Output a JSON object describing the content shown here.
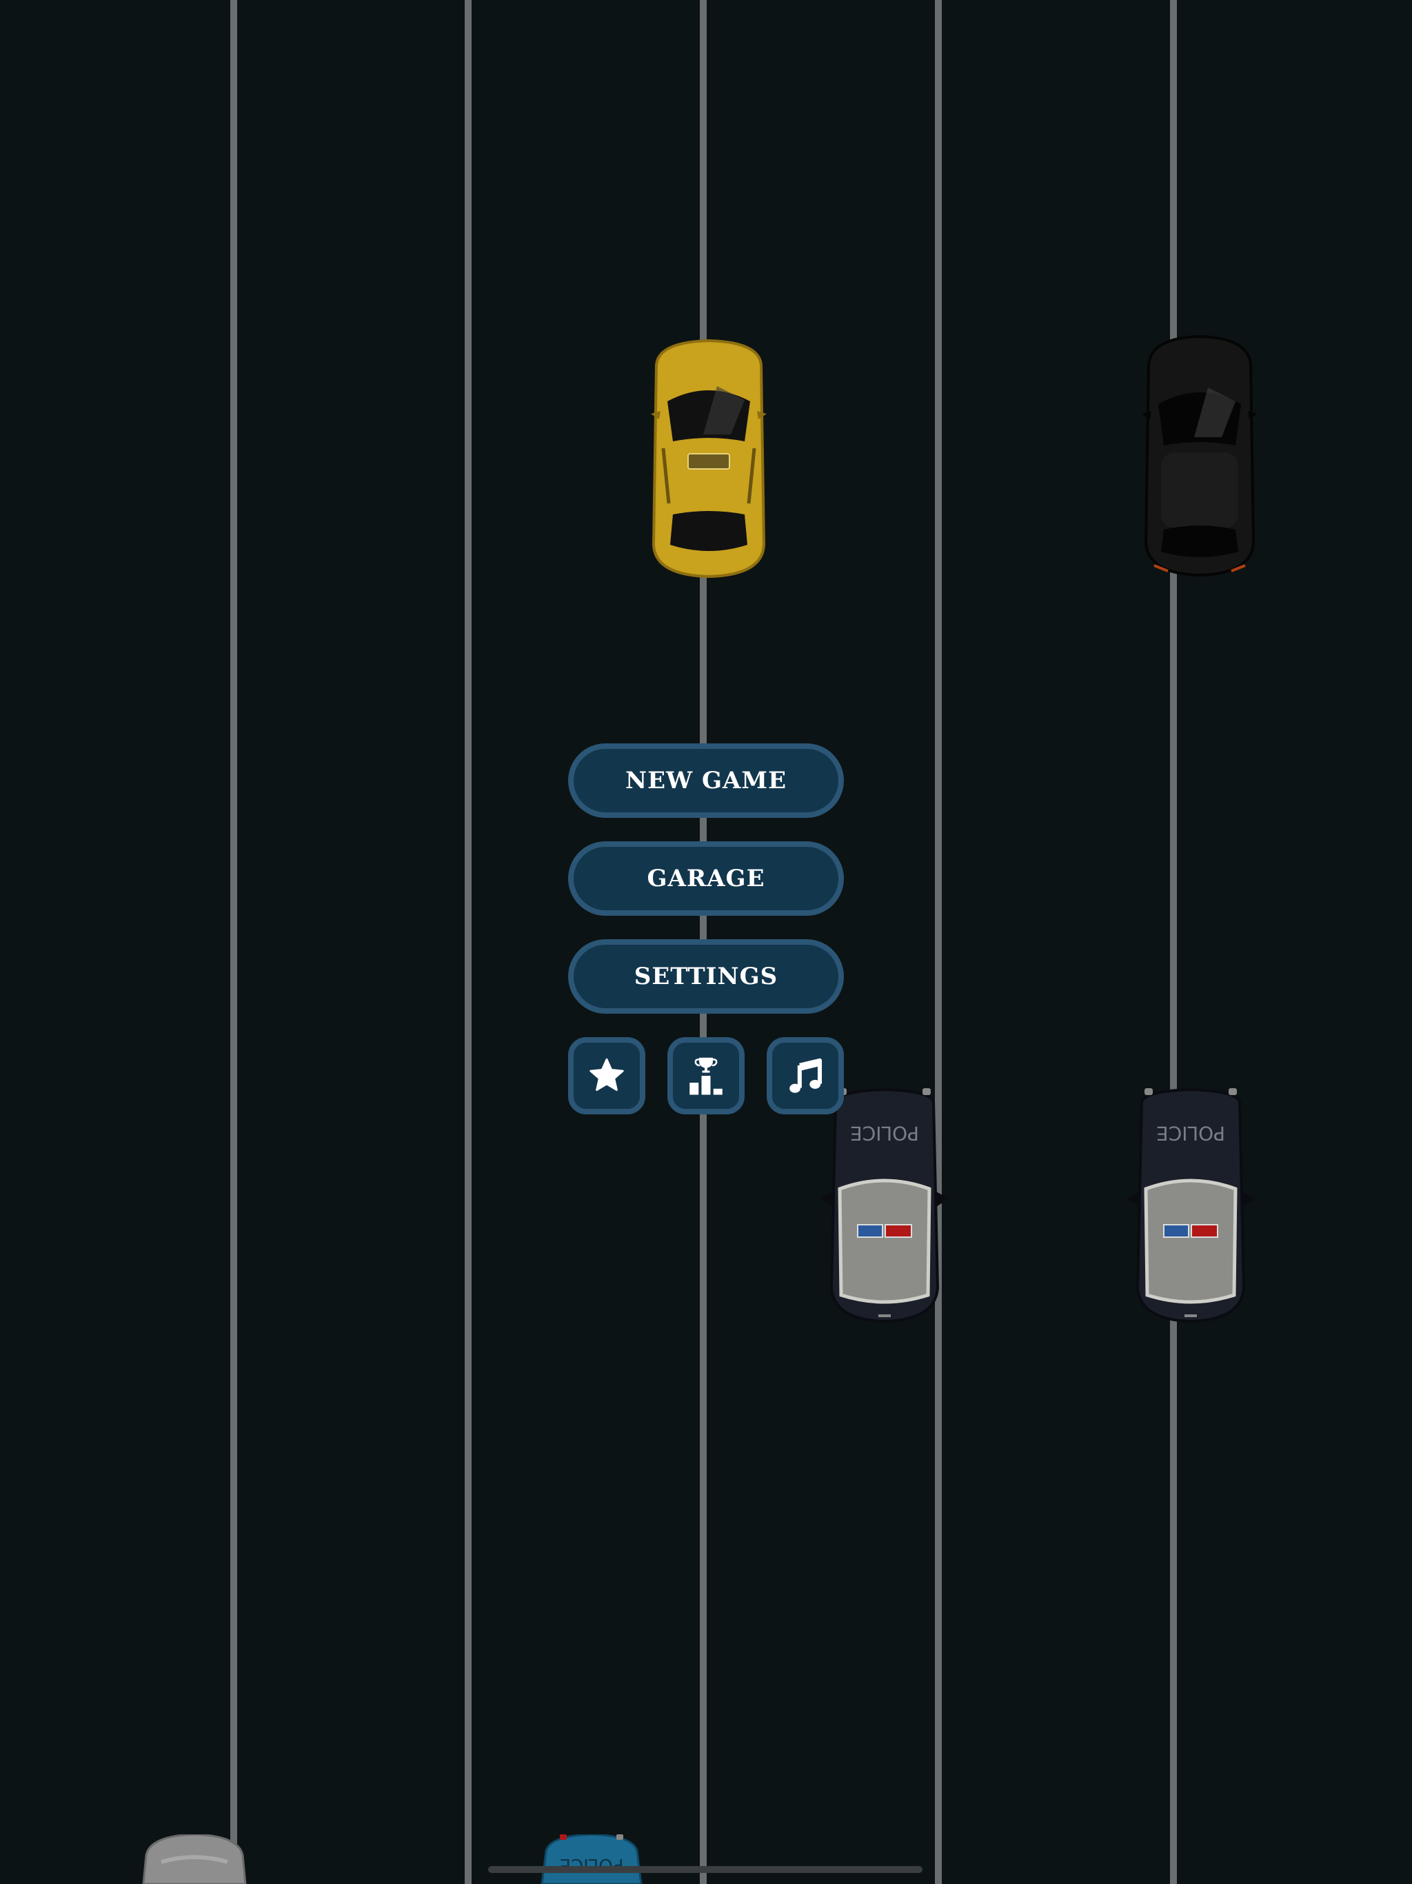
{
  "menu": {
    "new_game_label": "NEW GAME",
    "garage_label": "GARAGE",
    "settings_label": "SETTINGS"
  },
  "icons": {
    "rate": "star-icon",
    "leaderboard": "podium-trophy-icon",
    "music": "music-note-icon"
  },
  "cars": {
    "police_text": "POLICE"
  },
  "colors": {
    "road": "#0c1314",
    "lane_line": "#6b6e70",
    "button_fill": "#12364c",
    "button_border": "#2b5676",
    "taxi": "#c9a21e",
    "police_body": "#1b1f2a"
  }
}
